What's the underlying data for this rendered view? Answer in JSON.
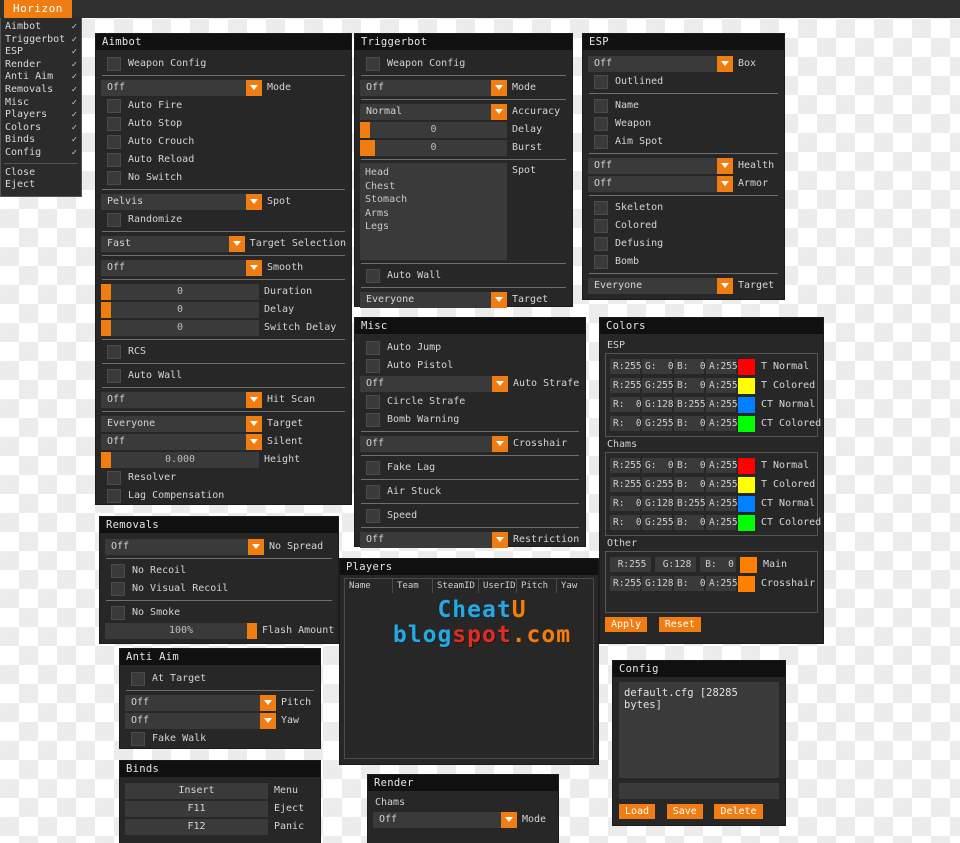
{
  "topbar": {
    "tab_label": "Horizon"
  },
  "main_menu": {
    "items": [
      {
        "label": "Aimbot",
        "checked": "✓"
      },
      {
        "label": "Triggerbot",
        "checked": "✓"
      },
      {
        "label": "ESP",
        "checked": "✓"
      },
      {
        "label": "Render",
        "checked": "✓"
      },
      {
        "label": "Anti Aim",
        "checked": "✓"
      },
      {
        "label": "Removals",
        "checked": "✓"
      },
      {
        "label": "Misc",
        "checked": "✓"
      },
      {
        "label": "Players",
        "checked": "✓"
      },
      {
        "label": "Colors",
        "checked": "✓"
      },
      {
        "label": "Binds",
        "checked": "✓"
      },
      {
        "label": "Config",
        "checked": "✓"
      }
    ],
    "close_label": "Close",
    "eject_label": "Eject"
  },
  "aimbot": {
    "title": "Aimbot",
    "weapon_config": "Weapon Config",
    "mode": {
      "value": "Off",
      "label": "Mode"
    },
    "auto_fire": "Auto Fire",
    "auto_stop": "Auto Stop",
    "auto_crouch": "Auto Crouch",
    "auto_reload": "Auto Reload",
    "no_switch": "No Switch",
    "spot": {
      "value": "Pelvis",
      "label": "Spot"
    },
    "randomize": "Randomize",
    "target_selection": {
      "value": "Fast",
      "label": "Target Selection"
    },
    "smooth": {
      "value": "Off",
      "label": "Smooth"
    },
    "duration": {
      "value": "0",
      "label": "Duration"
    },
    "delay": {
      "value": "0",
      "label": "Delay"
    },
    "switch_delay": {
      "value": "0",
      "label": "Switch Delay"
    },
    "rcs": "RCS",
    "auto_wall": "Auto Wall",
    "hit_scan": {
      "value": "Off",
      "label": "Hit Scan"
    },
    "target": {
      "value": "Everyone",
      "label": "Target"
    },
    "silent": {
      "value": "Off",
      "label": "Silent"
    },
    "height": {
      "value": "0.000",
      "label": "Height"
    },
    "resolver": "Resolver",
    "lag_compensation": "Lag Compensation"
  },
  "triggerbot": {
    "title": "Triggerbot",
    "weapon_config": "Weapon Config",
    "mode": {
      "value": "Off",
      "label": "Mode"
    },
    "accuracy": {
      "value": "Normal",
      "label": "Accuracy"
    },
    "delay": {
      "value": "0",
      "label": "Delay"
    },
    "burst": {
      "value": "0",
      "label": "Burst"
    },
    "spot_label": "Spot",
    "spot_items": [
      "Head",
      "Chest",
      "Stomach",
      "Arms",
      "Legs"
    ],
    "auto_wall": "Auto Wall",
    "target": {
      "value": "Everyone",
      "label": "Target"
    }
  },
  "esp": {
    "title": "ESP",
    "box": {
      "value": "Off",
      "label": "Box"
    },
    "outlined": "Outlined",
    "name": "Name",
    "weapon": "Weapon",
    "aim_spot": "Aim Spot",
    "health": {
      "value": "Off",
      "label": "Health"
    },
    "armor": {
      "value": "Off",
      "label": "Armor"
    },
    "skeleton": "Skeleton",
    "colored": "Colored",
    "defusing": "Defusing",
    "bomb": "Bomb",
    "target": {
      "value": "Everyone",
      "label": "Target"
    }
  },
  "misc": {
    "title": "Misc",
    "auto_jump": "Auto Jump",
    "auto_pistol": "Auto Pistol",
    "auto_strafe": {
      "value": "Off",
      "label": "Auto Strafe"
    },
    "circle_strafe": "Circle Strafe",
    "bomb_warning": "Bomb Warning",
    "crosshair": {
      "value": "Off",
      "label": "Crosshair"
    },
    "fake_lag": "Fake Lag",
    "air_stuck": "Air Stuck",
    "speed": "Speed",
    "restriction": {
      "value": "Off",
      "label": "Restriction"
    }
  },
  "removals": {
    "title": "Removals",
    "no_spread": {
      "value": "Off",
      "label": "No Spread"
    },
    "no_recoil": "No Recoil",
    "no_visual_recoil": "No Visual Recoil",
    "no_smoke": "No Smoke",
    "flash_amount": {
      "value": "100%",
      "label": "Flash Amount",
      "pct": 100
    }
  },
  "anti_aim": {
    "title": "Anti Aim",
    "at_target": "At Target",
    "pitch": {
      "value": "Off",
      "label": "Pitch"
    },
    "yaw": {
      "value": "Off",
      "label": "Yaw"
    },
    "fake_walk": "Fake Walk"
  },
  "binds": {
    "title": "Binds",
    "rows": [
      {
        "key": "Insert",
        "label": "Menu"
      },
      {
        "key": "F11",
        "label": "Eject"
      },
      {
        "key": "F12",
        "label": "Panic"
      }
    ]
  },
  "players": {
    "title": "Players",
    "columns": [
      "Name",
      "Team",
      "SteamID",
      "UserID",
      "Pitch",
      "Yaw"
    ],
    "rows": []
  },
  "render": {
    "title": "Render",
    "chams_label": "Chams",
    "mode": {
      "value": "Off",
      "label": "Mode"
    }
  },
  "colors": {
    "title": "Colors",
    "esp_group": "ESP",
    "chams_group": "Chams",
    "other_group": "Other",
    "esp_rows": [
      {
        "r": "R:255",
        "g": "G:  0",
        "b": "B:  0",
        "a": "A:255",
        "swatch": "#ff0000",
        "label": "T Normal"
      },
      {
        "r": "R:255",
        "g": "G:255",
        "b": "B:  0",
        "a": "A:255",
        "swatch": "#ffff00",
        "label": "T Colored"
      },
      {
        "r": "R:  0",
        "g": "G:128",
        "b": "B:255",
        "a": "A:255",
        "swatch": "#0080ff",
        "label": "CT Normal"
      },
      {
        "r": "R:  0",
        "g": "G:255",
        "b": "B:  0",
        "a": "A:255",
        "swatch": "#00ff00",
        "label": "CT Colored"
      }
    ],
    "chams_rows": [
      {
        "r": "R:255",
        "g": "G:  0",
        "b": "B:  0",
        "a": "A:255",
        "swatch": "#ff0000",
        "label": "T Normal"
      },
      {
        "r": "R:255",
        "g": "G:255",
        "b": "B:  0",
        "a": "A:255",
        "swatch": "#ffff00",
        "label": "T Colored"
      },
      {
        "r": "R:  0",
        "g": "G:128",
        "b": "B:255",
        "a": "A:255",
        "swatch": "#0080ff",
        "label": "CT Normal"
      },
      {
        "r": "R:  0",
        "g": "G:255",
        "b": "B:  0",
        "a": "A:255",
        "swatch": "#00ff00",
        "label": "CT Colored"
      }
    ],
    "other_rows": [
      {
        "r": "R:255",
        "g": "G:128",
        "b": "B:  0",
        "a": "",
        "swatch": "#ff8000",
        "label": "Main"
      },
      {
        "r": "R:255",
        "g": "G:128",
        "b": "B:  0",
        "a": "A:255",
        "swatch": "#ff8000",
        "label": "Crosshair"
      }
    ],
    "apply_label": "Apply",
    "reset_label": "Reset"
  },
  "config": {
    "title": "Config",
    "file_entry": "default.cfg [28285 bytes]",
    "input_value": "",
    "load_label": "Load",
    "save_label": "Save",
    "delete_label": "Delete"
  },
  "watermark": {
    "line1_a": "Cheat",
    "line1_b": "U",
    "line2_a": "blog",
    "line2_b": "spot",
    "line2_c": ".com"
  },
  "theme": {
    "accent": "#f07d12",
    "panel": "#272727",
    "title": "#101010"
  }
}
